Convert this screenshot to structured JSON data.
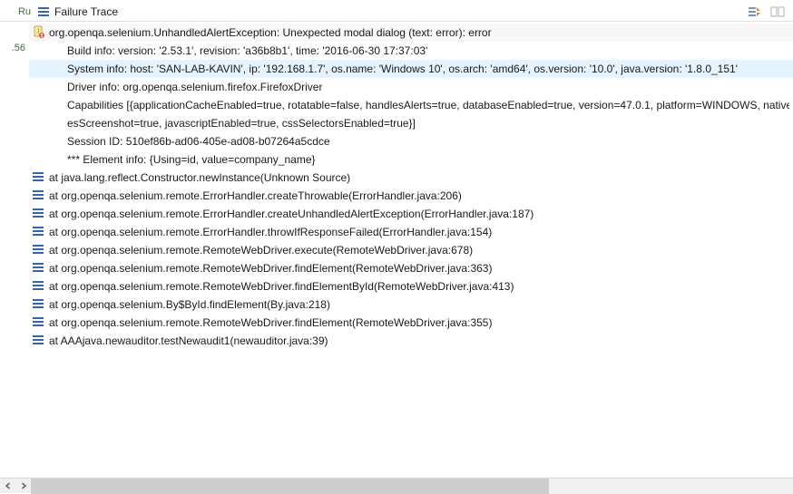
{
  "left_gutter": {
    "ru": "Ru",
    "secs": ".56"
  },
  "header": {
    "title": "Failure Trace"
  },
  "buttons": {
    "filter_tooltip": "Filter Stack Trace",
    "compare_tooltip": "Compare Results"
  },
  "trace": {
    "exception_line": "org.openqa.selenium.UnhandledAlertException: Unexpected modal dialog (text: error): error",
    "info_lines": [
      "Build info: version: '2.53.1', revision: 'a36b8b1', time: '2016-06-30 17:37:03'",
      "System info: host: 'SAN-LAB-KAVIN', ip: '192.168.1.7', os.name: 'Windows 10', os.arch: 'amd64', os.version: '10.0', java.version: '1.8.0_151'",
      "Driver info: org.openqa.selenium.firefox.FirefoxDriver",
      "Capabilities [{applicationCacheEnabled=true, rotatable=false, handlesAlerts=true, databaseEnabled=true, version=47.0.1, platform=WINDOWS, nativeEvents=",
      "esScreenshot=true, javascriptEnabled=true, cssSelectorsEnabled=true}]",
      "Session ID: 510ef86b-ad06-405e-ad08-b07264a5cdce",
      "*** Element info: {Using=id, value=company_name}"
    ],
    "highlighted_info_index": 1,
    "stack_frames": [
      "at java.lang.reflect.Constructor.newInstance(Unknown Source)",
      "at org.openqa.selenium.remote.ErrorHandler.createThrowable(ErrorHandler.java:206)",
      "at org.openqa.selenium.remote.ErrorHandler.createUnhandledAlertException(ErrorHandler.java:187)",
      "at org.openqa.selenium.remote.ErrorHandler.throwIfResponseFailed(ErrorHandler.java:154)",
      "at org.openqa.selenium.remote.RemoteWebDriver.execute(RemoteWebDriver.java:678)",
      "at org.openqa.selenium.remote.RemoteWebDriver.findElement(RemoteWebDriver.java:363)",
      "at org.openqa.selenium.remote.RemoteWebDriver.findElementById(RemoteWebDriver.java:413)",
      "at org.openqa.selenium.By$ById.findElement(By.java:218)",
      "at org.openqa.selenium.remote.RemoteWebDriver.findElement(RemoteWebDriver.java:355)",
      "at AAAjava.newauditor.testNewaudit1(newauditor.java:39)"
    ]
  }
}
